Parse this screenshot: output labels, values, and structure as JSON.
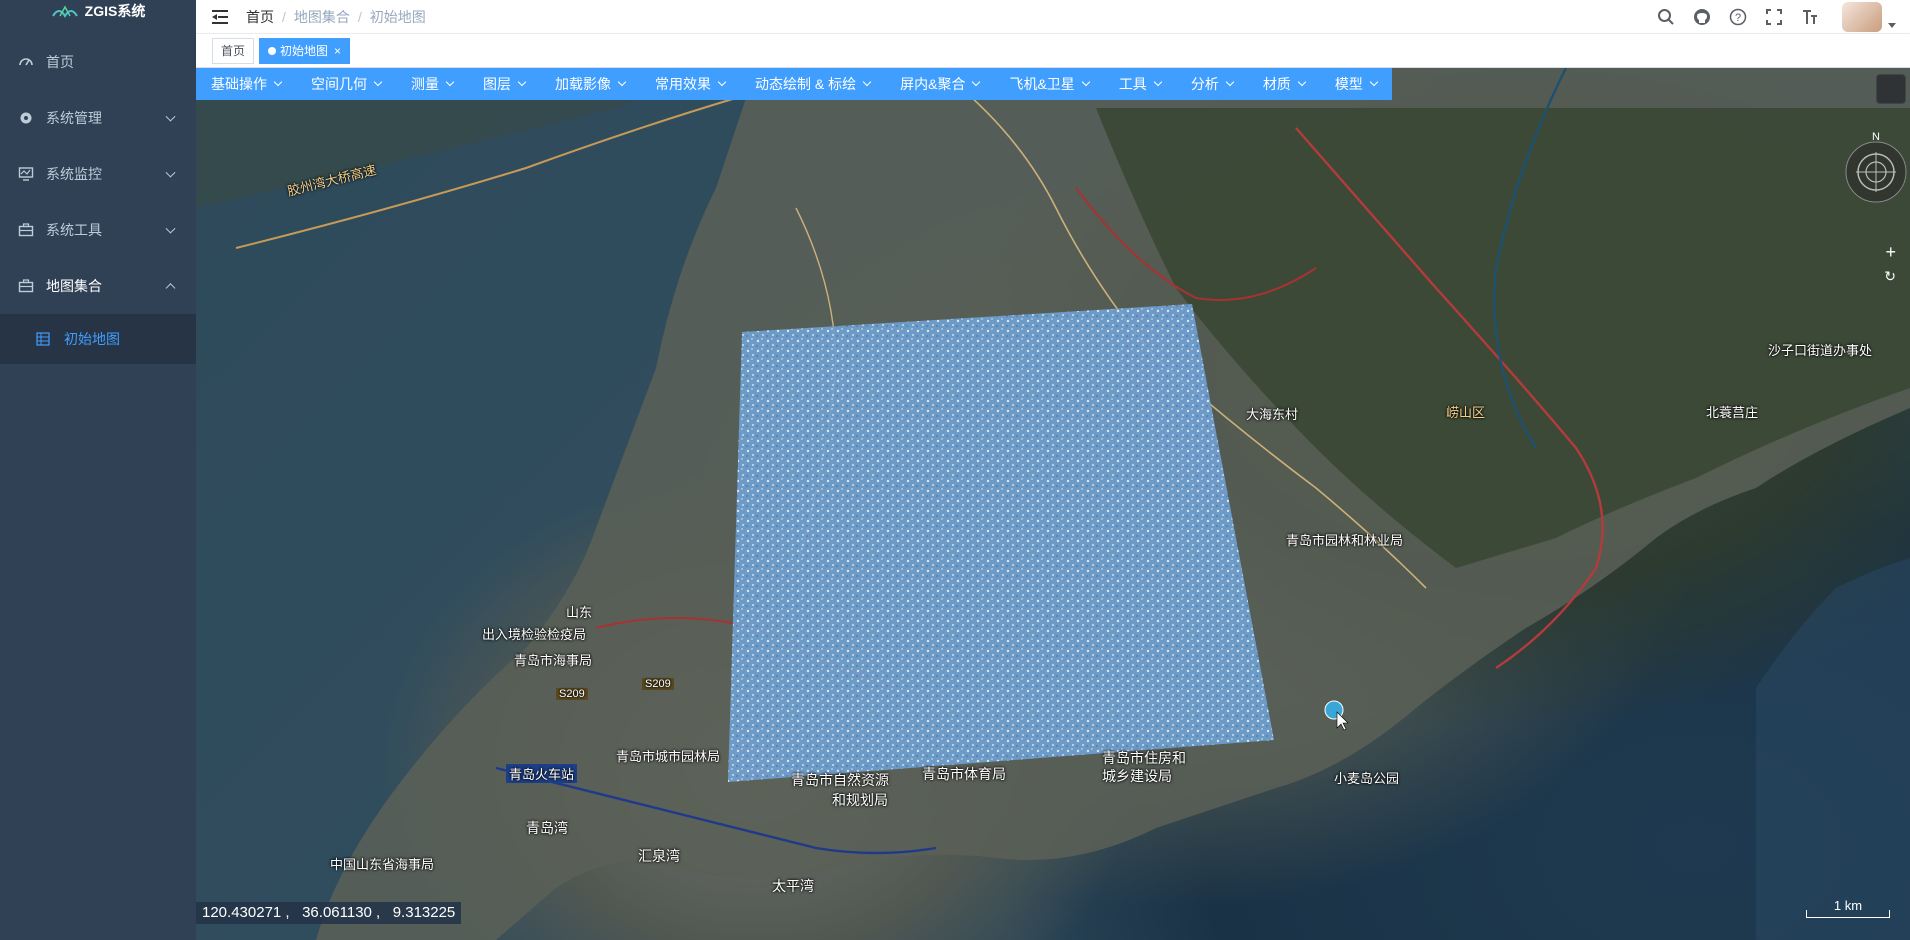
{
  "app": {
    "title": "ZGIS系统"
  },
  "sidebar": {
    "items": [
      {
        "label": "首页",
        "icon": "dashboard-icon"
      },
      {
        "label": "系统管理",
        "icon": "gear-icon"
      },
      {
        "label": "系统监控",
        "icon": "monitor-icon"
      },
      {
        "label": "系统工具",
        "icon": "toolbox-icon"
      },
      {
        "label": "地图集合",
        "icon": "toolbox-icon"
      }
    ],
    "submenu": [
      {
        "label": "初始地图",
        "icon": "grid-icon"
      }
    ]
  },
  "navbar": {
    "breadcrumb": [
      "首页",
      "地图集合",
      "初始地图"
    ],
    "separator": "/"
  },
  "tags": [
    {
      "label": "首页",
      "active": false
    },
    {
      "label": "初始地图",
      "active": true,
      "close": "×"
    }
  ],
  "toolbar": {
    "row1": [
      "基础操作",
      "空间几何",
      "测量",
      "图层",
      "加载影像",
      "常用效果",
      "动态绘制 & 标绘",
      "屏内&聚合",
      "飞机&卫星",
      "工具",
      "分析",
      "材质"
    ],
    "row2": [
      "模型"
    ]
  },
  "map": {
    "labels": [
      "胶州湾大桥高速",
      "青岛市园林和林业局",
      "青岛市城市园林局",
      "青岛市自然资源",
      "和规划局",
      "青岛市体育局",
      "青岛市住房和",
      "城乡建设局",
      "小麦岛公园",
      "青岛火车站",
      "青岛湾",
      "汇泉湾",
      "太平湾",
      "中国山东省海事局",
      "出入境检验检疫局",
      "青岛市海事局",
      "山东",
      "崂山区",
      "北蓑莒庄",
      "大海东村",
      "沙子口街道办事处",
      "S209",
      "S209"
    ],
    "coordinates": "120.430271 ,   36.061130 ,   9.313225",
    "scale_label": "1 km",
    "compass_n": "N",
    "zoom_in": "+",
    "reset": "↻"
  }
}
